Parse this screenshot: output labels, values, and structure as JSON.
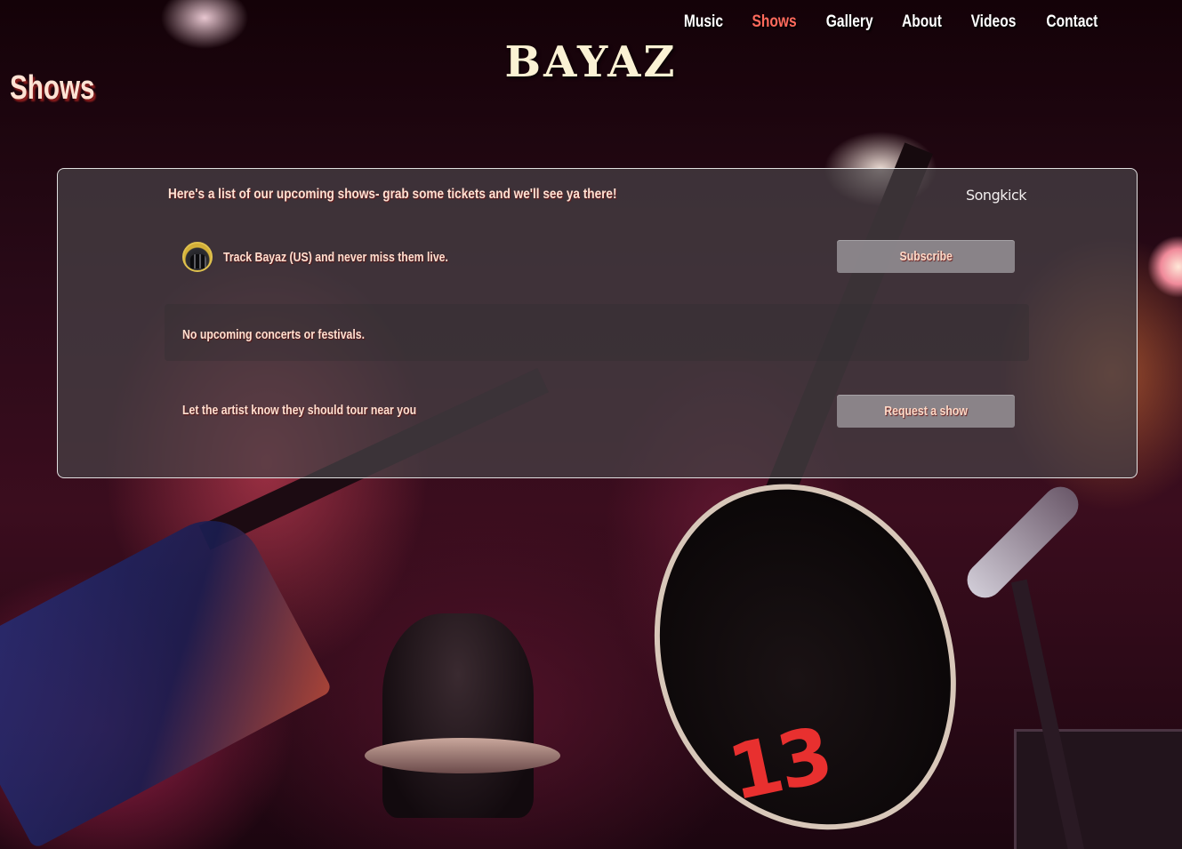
{
  "site": {
    "logo": "BAYAZ"
  },
  "nav": {
    "items": [
      {
        "label": "Music"
      },
      {
        "label": "Shows"
      },
      {
        "label": "Gallery"
      },
      {
        "label": "About"
      },
      {
        "label": "Videos"
      },
      {
        "label": "Contact"
      }
    ],
    "active": "Shows"
  },
  "page": {
    "title": "Shows"
  },
  "panel": {
    "heading": "Here's a list of our upcoming shows- grab some tickets and we'll see ya there!",
    "provider_logo": "Songkick",
    "track_text": "Track Bayaz (US) and never miss them live.",
    "subscribe_label": "Subscribe",
    "empty_text": "No upcoming concerts or festivals.",
    "request_text": "Let the artist know they should tour near you",
    "request_label": "Request a show"
  },
  "colors": {
    "nav_active": "#ff6a5c",
    "nav_text": "#ffffff",
    "title_text": "#ffe3d4",
    "logo_text": "#fbf2d4",
    "panel_bg": "rgba(72,66,70,0.72)",
    "button_bg": "rgba(150,146,150,0.85)"
  },
  "background": {
    "jersey_number": "13"
  }
}
